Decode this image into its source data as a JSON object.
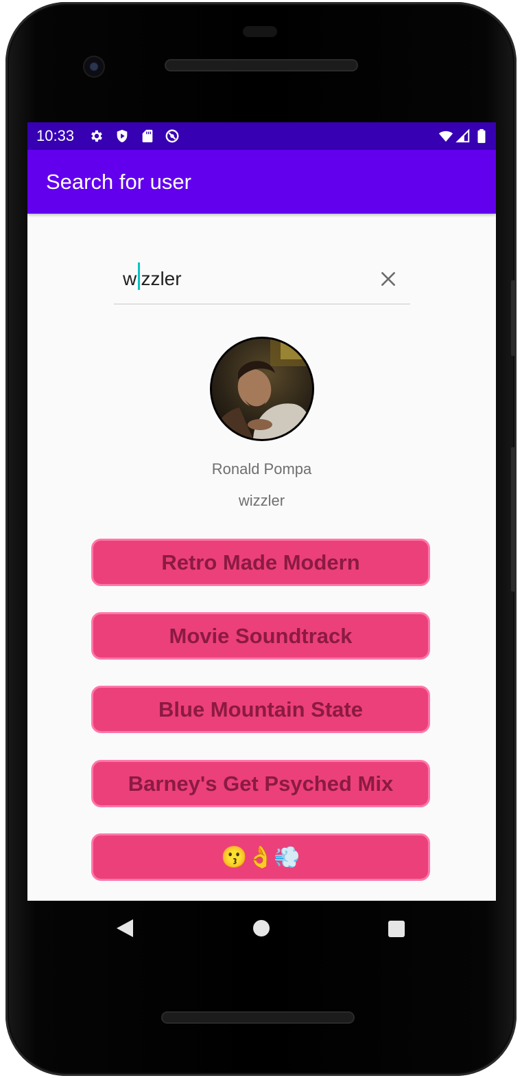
{
  "status_bar": {
    "time": "10:33",
    "left_icons": [
      "settings-icon",
      "shield-play-icon",
      "sd-card-icon",
      "sync-disabled-icon"
    ],
    "right_icons": [
      "wifi-icon",
      "cell-signal-icon",
      "battery-icon"
    ]
  },
  "app_bar": {
    "title": "Search for user"
  },
  "search": {
    "value": "wizzler",
    "clear_icon": "close-icon"
  },
  "profile": {
    "display_name": "Ronald Pompa",
    "username": "wizzler"
  },
  "playlists": [
    {
      "label": "Retro Made Modern"
    },
    {
      "label": "Movie Soundtrack"
    },
    {
      "label": "Blue Mountain State"
    },
    {
      "label": "Barney's Get Psyched Mix"
    },
    {
      "label": "😗👌💨"
    }
  ],
  "nav_bar": {
    "buttons": [
      "back-icon",
      "home-icon",
      "recents-icon"
    ]
  },
  "colors": {
    "status_bar": "#3700b3",
    "app_bar": "#6200ee",
    "button_fill": "#ec407a",
    "button_border": "#ff77a9",
    "button_text": "#8b1a42"
  }
}
